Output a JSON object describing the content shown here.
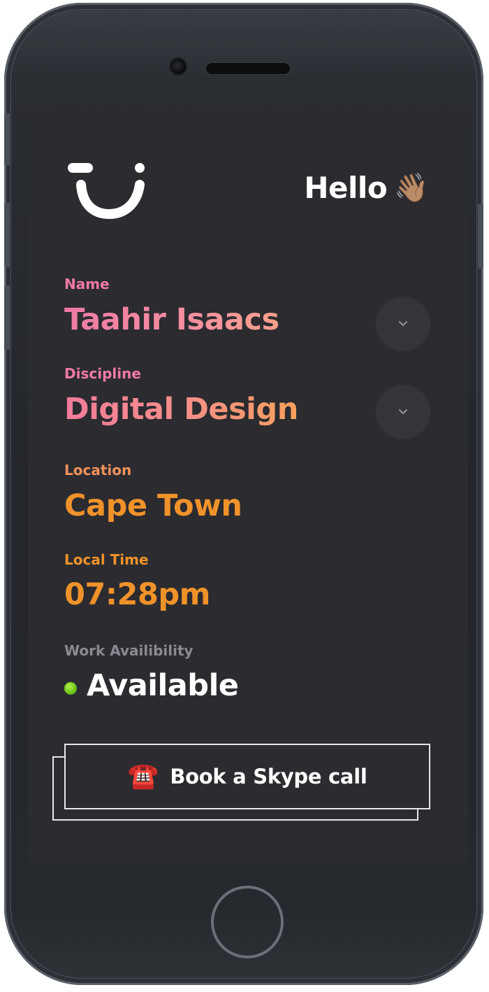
{
  "header": {
    "greeting": "Hello",
    "greeting_emoji": "👋🏽",
    "logo_icon": "smile-logo"
  },
  "profile": {
    "name": {
      "label": "Name",
      "value": "Taahir Isaacs"
    },
    "discipline": {
      "label": "Discipline",
      "value": "Digital Design"
    },
    "location": {
      "label": "Location",
      "value": "Cape Town"
    },
    "local_time": {
      "label": "Local Time",
      "value": "07:28pm"
    },
    "availability": {
      "label": "Work Availibility",
      "value": "Available",
      "status_color": "#6cc21a"
    }
  },
  "cta": {
    "icon": "☎️",
    "label": "Book a Skype call"
  },
  "colors": {
    "screen_bg": "#2b2b30",
    "pink": "#f07aa3",
    "orange": "#f0922a",
    "muted_label": "#8a8a92"
  }
}
